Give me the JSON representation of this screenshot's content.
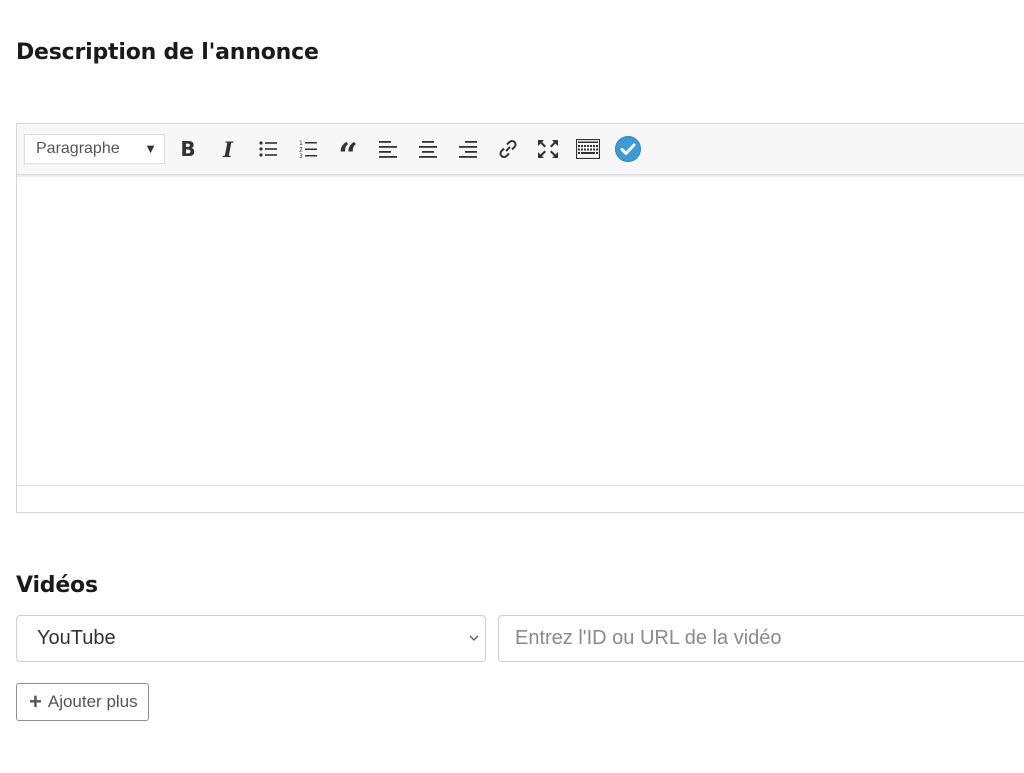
{
  "description": {
    "title": "Description de l'annonce",
    "toolbar": {
      "format_select": "Paragraphe",
      "buttons": [
        {
          "name": "bold-button",
          "icon": "bold-icon",
          "label": "B"
        },
        {
          "name": "italic-button",
          "icon": "italic-icon",
          "label": "I"
        },
        {
          "name": "bulleted-list-button",
          "icon": "bulleted-list-icon"
        },
        {
          "name": "numbered-list-button",
          "icon": "numbered-list-icon"
        },
        {
          "name": "blockquote-button",
          "icon": "blockquote-icon",
          "label": "“"
        },
        {
          "name": "align-left-button",
          "icon": "align-left-icon"
        },
        {
          "name": "align-center-button",
          "icon": "align-center-icon"
        },
        {
          "name": "align-right-button",
          "icon": "align-right-icon"
        },
        {
          "name": "insert-link-button",
          "icon": "link-icon"
        },
        {
          "name": "fullscreen-button",
          "icon": "fullscreen-icon"
        },
        {
          "name": "toolbar-toggle-button",
          "icon": "keyboard-icon"
        },
        {
          "name": "spellcheck-button",
          "icon": "check-circle-icon"
        }
      ]
    },
    "content": ""
  },
  "videos": {
    "title": "Vidéos",
    "provider_select": "YouTube",
    "url_input": {
      "value": "",
      "placeholder": "Entrez l'ID ou URL de la vidéo"
    },
    "add_more_label": "Ajouter plus"
  },
  "colors": {
    "check_badge": "#3d9ad6",
    "toolbar_bg": "#f7f7f7",
    "border": "#d6d6d6"
  }
}
